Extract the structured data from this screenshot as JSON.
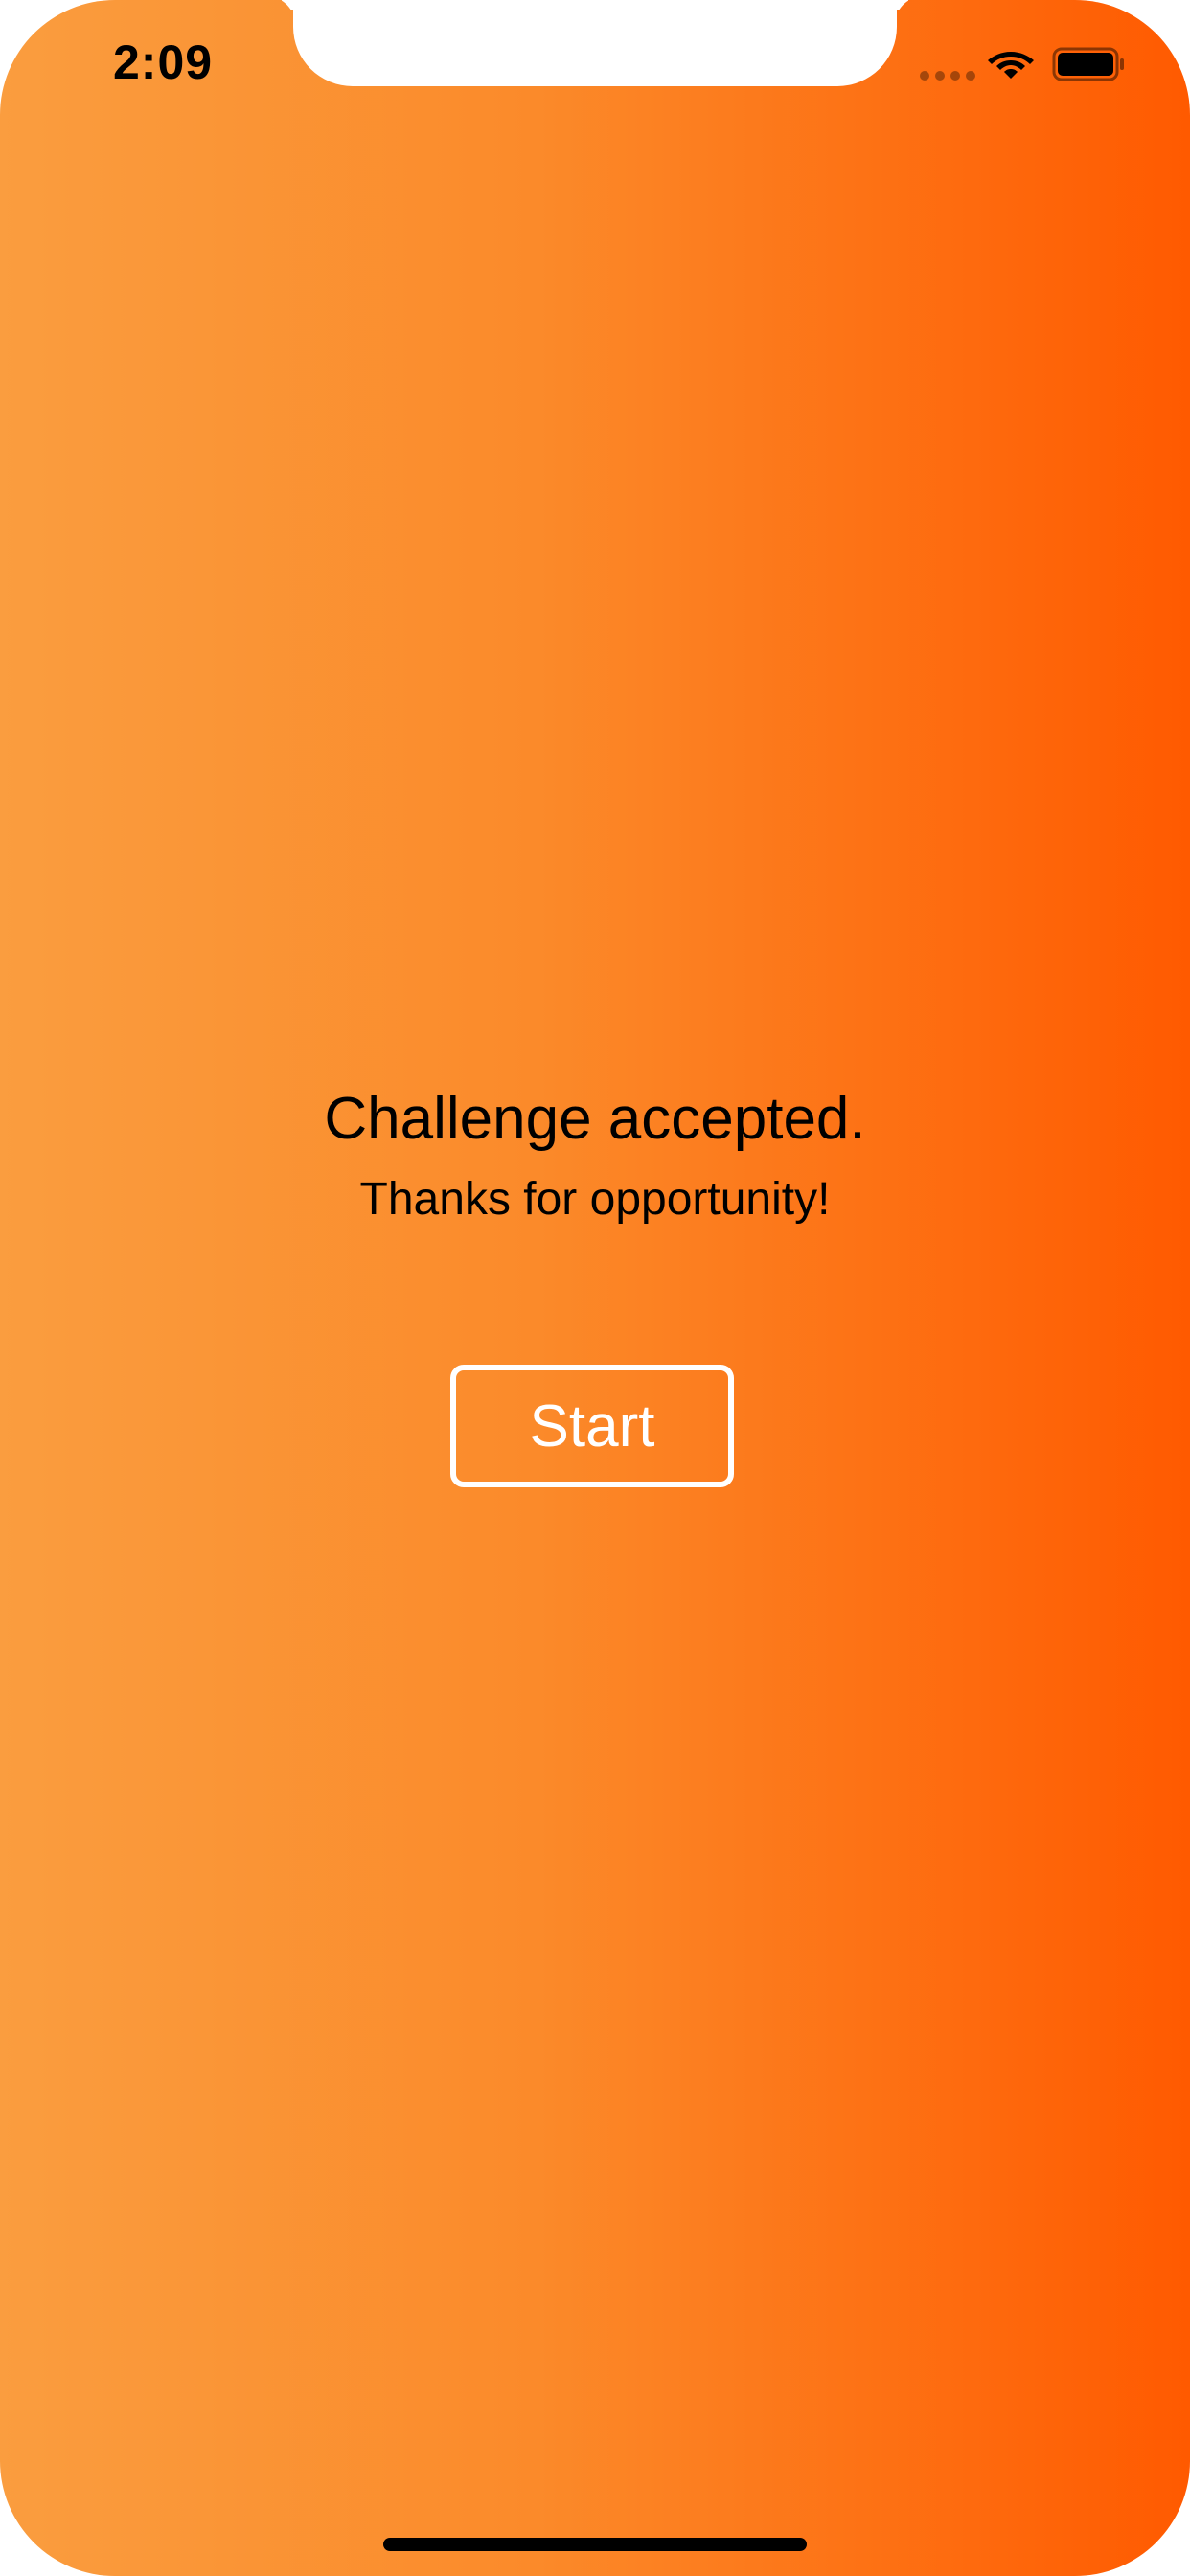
{
  "status_bar": {
    "time": "2:09",
    "wifi_icon": "wifi-icon",
    "battery_icon": "battery-icon",
    "signal_icon": "signal-dots-icon"
  },
  "main": {
    "headline": "Challenge accepted.",
    "subline": "Thanks for opportunity!",
    "start_label": "Start"
  },
  "colors": {
    "gradient_start": "#fa9d3f",
    "gradient_end": "#ff5a00",
    "text": "#000000",
    "button_border": "#ffffff"
  }
}
